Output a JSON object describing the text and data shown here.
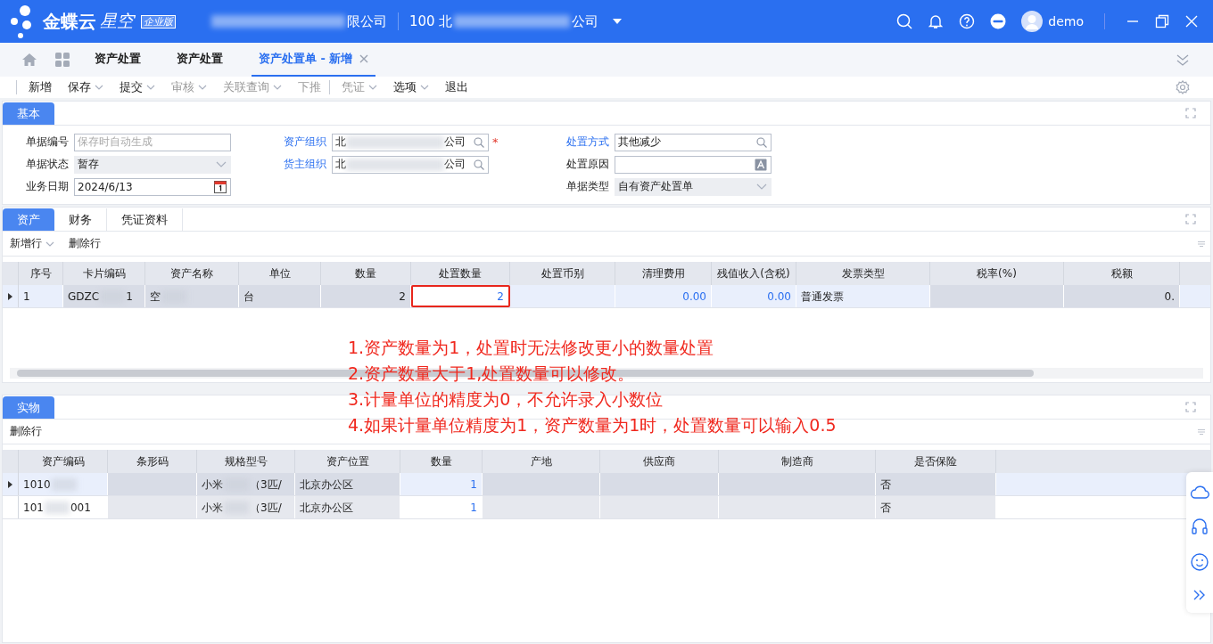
{
  "header": {
    "logo": "金蝶云",
    "logo_sub": "星空",
    "edition": "企业版",
    "company": {
      "tail": "限公司"
    },
    "org": {
      "head": "100 北",
      "tail": "公司"
    },
    "user": "demo"
  },
  "tabs": [
    {
      "label": "资产处置",
      "selected": false,
      "closable": false
    },
    {
      "label": "资产处置",
      "selected": false,
      "closable": false
    },
    {
      "label": "资产处置单 - 新增",
      "selected": true,
      "closable": true
    }
  ],
  "toolbar": [
    {
      "label": "新增",
      "disabled": false,
      "menu": false
    },
    {
      "label": "保存",
      "disabled": false,
      "menu": true
    },
    {
      "label": "提交",
      "disabled": false,
      "menu": true
    },
    {
      "label": "审核",
      "disabled": true,
      "menu": true
    },
    {
      "label": "关联查询",
      "disabled": true,
      "menu": true
    },
    {
      "label": "下推",
      "disabled": true,
      "menu": false
    },
    {
      "label": "凭证",
      "disabled": true,
      "menu": true
    },
    {
      "label": "选项",
      "disabled": false,
      "menu": true
    },
    {
      "label": "退出",
      "disabled": false,
      "menu": false
    }
  ],
  "basic": {
    "title": "基本",
    "columns": [
      [
        {
          "label": "单据编号",
          "link": false,
          "kind": "text",
          "placeholder": "保存时自动生成"
        },
        {
          "label": "单据状态",
          "link": false,
          "kind": "select",
          "value": "暂存",
          "readonly": true
        },
        {
          "label": "业务日期",
          "link": false,
          "kind": "date",
          "value": "2024/6/13"
        }
      ],
      [
        {
          "label": "资产组织",
          "link": true,
          "kind": "search",
          "blurred": {
            "head": "北",
            "tail": "公司"
          },
          "required_mark": "*"
        },
        {
          "label": "货主组织",
          "link": true,
          "kind": "search",
          "blurred": {
            "head": "北",
            "tail": "公司"
          }
        }
      ],
      [
        {
          "label": "处置方式",
          "link": true,
          "kind": "search",
          "value": "其他减少"
        },
        {
          "label": "处置原因",
          "link": false,
          "kind": "lang"
        },
        {
          "label": "单据类型",
          "link": false,
          "kind": "select",
          "value": "自有资产处置单",
          "readonly": true
        }
      ]
    ]
  },
  "asset_section": {
    "tabs": [
      {
        "label": "资产",
        "selected": true
      },
      {
        "label": "财务",
        "selected": false
      },
      {
        "label": "凭证资料",
        "selected": false
      }
    ],
    "actions": [
      {
        "label": "新增行",
        "menu": true
      },
      {
        "label": "删除行",
        "menu": false
      }
    ],
    "columns": [
      {
        "title": "序号",
        "readonly": false,
        "kind": "text"
      },
      {
        "title": "卡片编码",
        "readonly": true,
        "kind": "text"
      },
      {
        "title": "资产名称",
        "readonly": true,
        "kind": "text"
      },
      {
        "title": "单位",
        "readonly": true,
        "kind": "text"
      },
      {
        "title": "数量",
        "readonly": true,
        "kind": "number"
      },
      {
        "title": "处置数量",
        "readonly": false,
        "kind": "number"
      },
      {
        "title": "处置币别",
        "readonly": false,
        "kind": "text"
      },
      {
        "title": "清理费用",
        "readonly": false,
        "kind": "number"
      },
      {
        "title": "残值收入(含税)",
        "readonly": false,
        "kind": "number"
      },
      {
        "title": "发票类型",
        "readonly": false,
        "kind": "text"
      },
      {
        "title": "税率(%)",
        "readonly": true,
        "kind": "text"
      },
      {
        "title": "税额",
        "readonly": true,
        "kind": "number"
      }
    ],
    "rows": [
      {
        "selected": true,
        "cells": [
          "1",
          {
            "head": "GDZC",
            "tail": "1"
          },
          {
            "head": "空"
          },
          "台",
          "2",
          {
            "text": "2",
            "highlighted": true
          },
          "",
          "0.00",
          "0.00",
          "普通发票",
          "",
          "0."
        ]
      }
    ]
  },
  "annotation": [
    "1.资产数量为1，处置时无法修改更小的数量处置",
    "2.资产数量大于1,处置数量可以修改。",
    "3.计量单位的精度为0，不允许录入小数位",
    "4.如果计量单位精度为1，资产数量为1时，处置数量可以输入0.5"
  ],
  "physical_section": {
    "tabs": [
      {
        "label": "实物",
        "selected": true
      }
    ],
    "actions": [
      {
        "label": "删除行",
        "menu": false
      }
    ],
    "columns": [
      {
        "title": "资产编码",
        "readonly": false,
        "kind": "text"
      },
      {
        "title": "条形码",
        "readonly": true,
        "kind": "text"
      },
      {
        "title": "规格型号",
        "readonly": true,
        "kind": "text"
      },
      {
        "title": "资产位置",
        "readonly": true,
        "kind": "text"
      },
      {
        "title": "数量",
        "readonly": false,
        "kind": "number"
      },
      {
        "title": "产地",
        "readonly": true,
        "kind": "text"
      },
      {
        "title": "供应商",
        "readonly": true,
        "kind": "text"
      },
      {
        "title": "制造商",
        "readonly": true,
        "kind": "text"
      },
      {
        "title": "是否保险",
        "readonly": true,
        "kind": "text"
      }
    ],
    "rows": [
      {
        "selected": true,
        "cells": [
          {
            "head": "1010"
          },
          "",
          {
            "head": "小米",
            "tail": "（3匹/"
          },
          "北京办公区",
          "1",
          "",
          "",
          "",
          "否"
        ]
      },
      {
        "selected": false,
        "cells": [
          {
            "head": "101",
            "tail": "001"
          },
          "",
          {
            "head": "小米",
            "tail": "（3匹/"
          },
          "北京办公区",
          "1",
          "",
          "",
          "",
          "否"
        ]
      }
    ]
  }
}
